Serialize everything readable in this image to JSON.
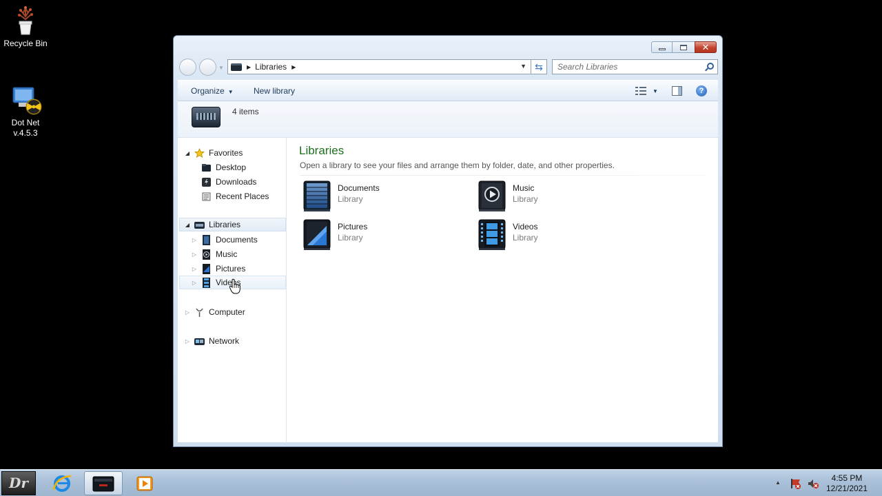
{
  "desktop": {
    "icons": [
      {
        "label": "Recycle Bin"
      },
      {
        "label": "Dot Net v.4.5.3"
      }
    ]
  },
  "window": {
    "address": {
      "crumb": "Libraries"
    },
    "search": {
      "placeholder": "Search Libraries"
    },
    "toolbar": {
      "organize_label": "Organize",
      "new_library_label": "New library"
    },
    "info": {
      "item_count": "4 items"
    },
    "nav": {
      "favorites_label": "Favorites",
      "favorites": [
        "Desktop",
        "Downloads",
        "Recent Places"
      ],
      "libraries_label": "Libraries",
      "libraries": [
        "Documents",
        "Music",
        "Pictures",
        "Videos"
      ],
      "computer_label": "Computer",
      "network_label": "Network"
    },
    "main": {
      "title": "Libraries",
      "subtitle": "Open a library to see your files and arrange them by folder, date, and other properties.",
      "items": [
        {
          "name": "Documents",
          "type": "Library",
          "icon": "documents-library-icon"
        },
        {
          "name": "Music",
          "type": "Library",
          "icon": "music-library-icon"
        },
        {
          "name": "Pictures",
          "type": "Library",
          "icon": "pictures-library-icon"
        },
        {
          "name": "Videos",
          "type": "Library",
          "icon": "videos-library-icon"
        }
      ]
    }
  },
  "taskbar": {
    "clock_time": "4:55 PM",
    "clock_date": "12/21/2021"
  }
}
